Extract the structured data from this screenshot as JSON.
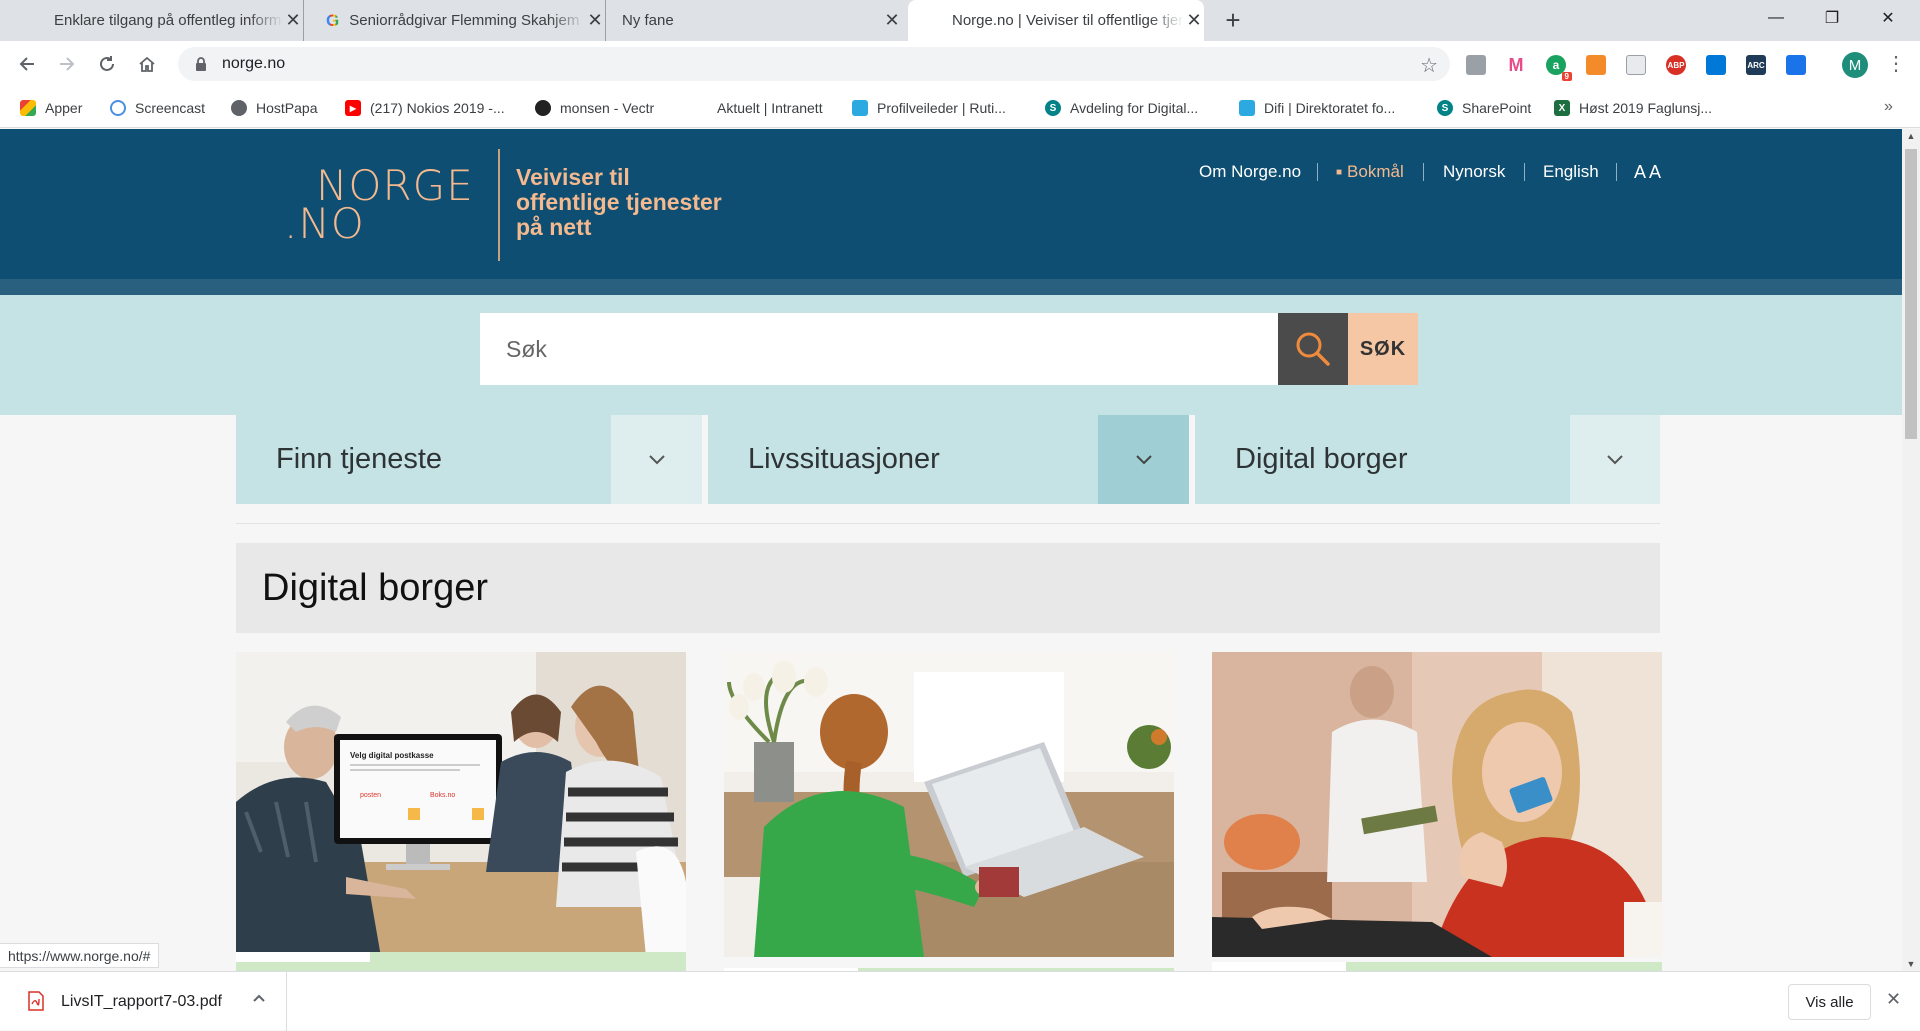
{
  "browser": {
    "tabs": [
      {
        "title": "Enklare tilgang på offentleg informasjon",
        "active": false
      },
      {
        "title": "Seniorrådgivar Flemming Skahjem",
        "active": false
      },
      {
        "title": "Ny fane",
        "active": false
      },
      {
        "title": "Norge.no | Veiviser til offentlige tjenester",
        "active": true
      }
    ],
    "new_tab": "+",
    "window_controls": {
      "minimize": "—",
      "maximize": "❐",
      "close": "✕"
    },
    "url": "norge.no",
    "bookmarks": [
      {
        "label": "Apper",
        "icon": "apps-grid-icon"
      },
      {
        "label": "Screencast",
        "icon": "screencast-icon"
      },
      {
        "label": "HostPapa",
        "icon": "globe-icon"
      },
      {
        "label": "(217) Nokios 2019 -...",
        "icon": "youtube-icon"
      },
      {
        "label": "monsen - Vectr",
        "icon": "vectr-icon"
      },
      {
        "label": "Aktuelt | Intranett",
        "icon": ""
      },
      {
        "label": "Profilveileder | Ruti...",
        "icon": "difi-icon"
      },
      {
        "label": "Avdeling for Digital...",
        "icon": "sharepoint-icon"
      },
      {
        "label": "Difi | Direktoratet fo...",
        "icon": "difi-icon"
      },
      {
        "label": "SharePoint",
        "icon": "sharepoint-icon"
      },
      {
        "label": "Høst 2019 Faglunsj...",
        "icon": "excel-icon"
      }
    ],
    "profile_initial": "M",
    "extension_badge": "9",
    "status_url": "https://www.norge.no/#"
  },
  "site": {
    "logo_line1": "NORGE",
    "logo_line2": ".NO",
    "tagline_1": "Veiviser til",
    "tagline_2": "offentlige tjenester",
    "tagline_3": "på nett",
    "top_nav": {
      "about": "Om Norge.no",
      "bokmal": "Bokmål",
      "nynorsk": "Nynorsk",
      "english": "English",
      "font_size": "A A"
    },
    "search": {
      "placeholder": "Søk",
      "button": "SØK"
    },
    "nav_cards": [
      {
        "label": "Finn tjeneste",
        "expanded": false
      },
      {
        "label": "Livssituasjoner",
        "expanded": true
      },
      {
        "label": "Digital borger",
        "expanded": false
      }
    ],
    "section_title": "Digital borger",
    "cards": [
      {
        "image": "senior-digital-postkasse-photo",
        "screen_title": "Velg digital postkasse",
        "screen_brands": [
          "posten",
          "Boks.no"
        ]
      },
      {
        "image": "woman-with-laptop-photo"
      },
      {
        "image": "woman-with-credit-card-photo"
      }
    ]
  },
  "downloads": {
    "file": "LivsIT_rapport7-03.pdf",
    "show_all": "Vis alle"
  },
  "colors": {
    "header_bg": "#0d4e72",
    "accent_peach": "#f4b98f",
    "search_band": "#c5e3e5",
    "card_band_green": "#cfe8c6"
  }
}
